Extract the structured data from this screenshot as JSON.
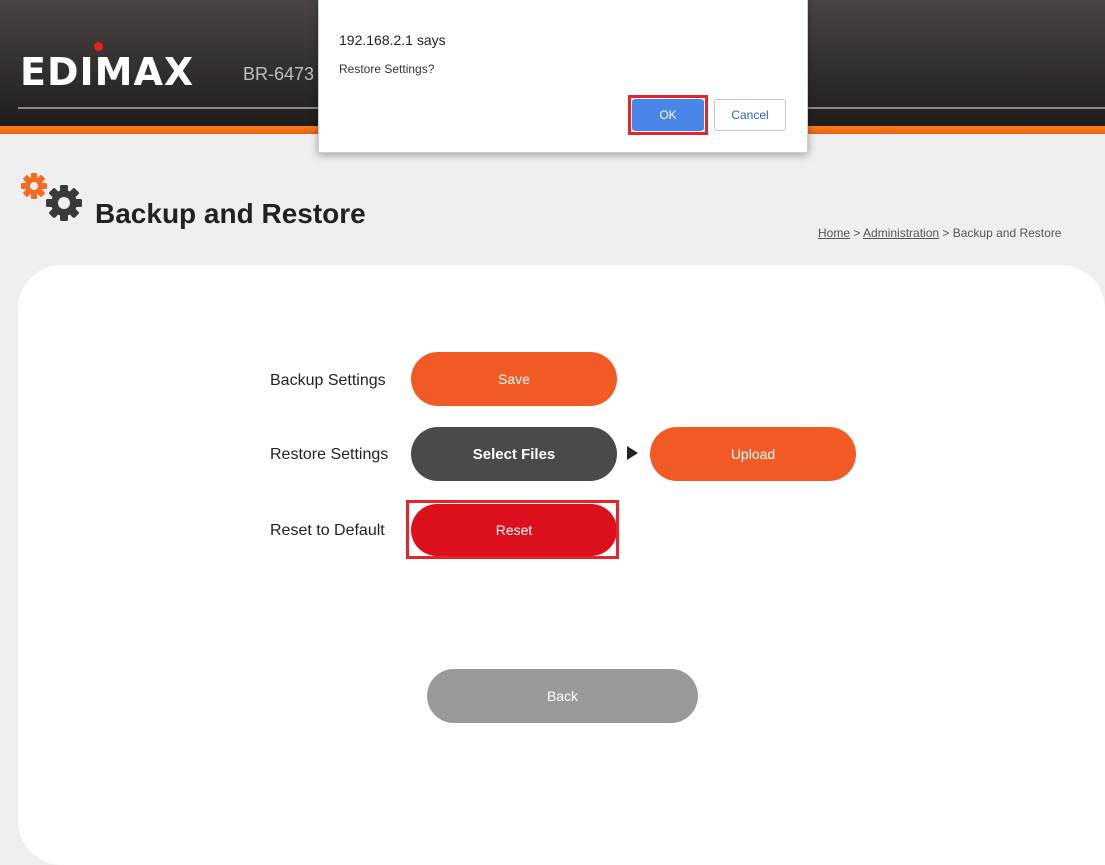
{
  "header": {
    "logo": "EDIMAX",
    "model": "BR-6473",
    "colors": {
      "bar": "#2b2726",
      "accent": "#f58220"
    }
  },
  "page": {
    "title": "Backup and Restore",
    "icon": "gears-icon",
    "breadcrumb": {
      "home": "Home",
      "sep1": " > ",
      "admin": "Administration",
      "sep2": " > ",
      "current": "Backup and Restore"
    }
  },
  "rows": {
    "backup_label": "Backup Settings",
    "save_label": "Save",
    "restore_label": "Restore Settings",
    "select_files_label": "Select Files",
    "upload_label": "Upload",
    "reset_label_text": "Reset to Default",
    "reset_button_label": "Reset"
  },
  "footer": {
    "back_label": "Back"
  },
  "dialog": {
    "title": "192.168.2.1 says",
    "message": "Restore Settings?",
    "ok_label": "OK",
    "cancel_label": "Cancel"
  }
}
